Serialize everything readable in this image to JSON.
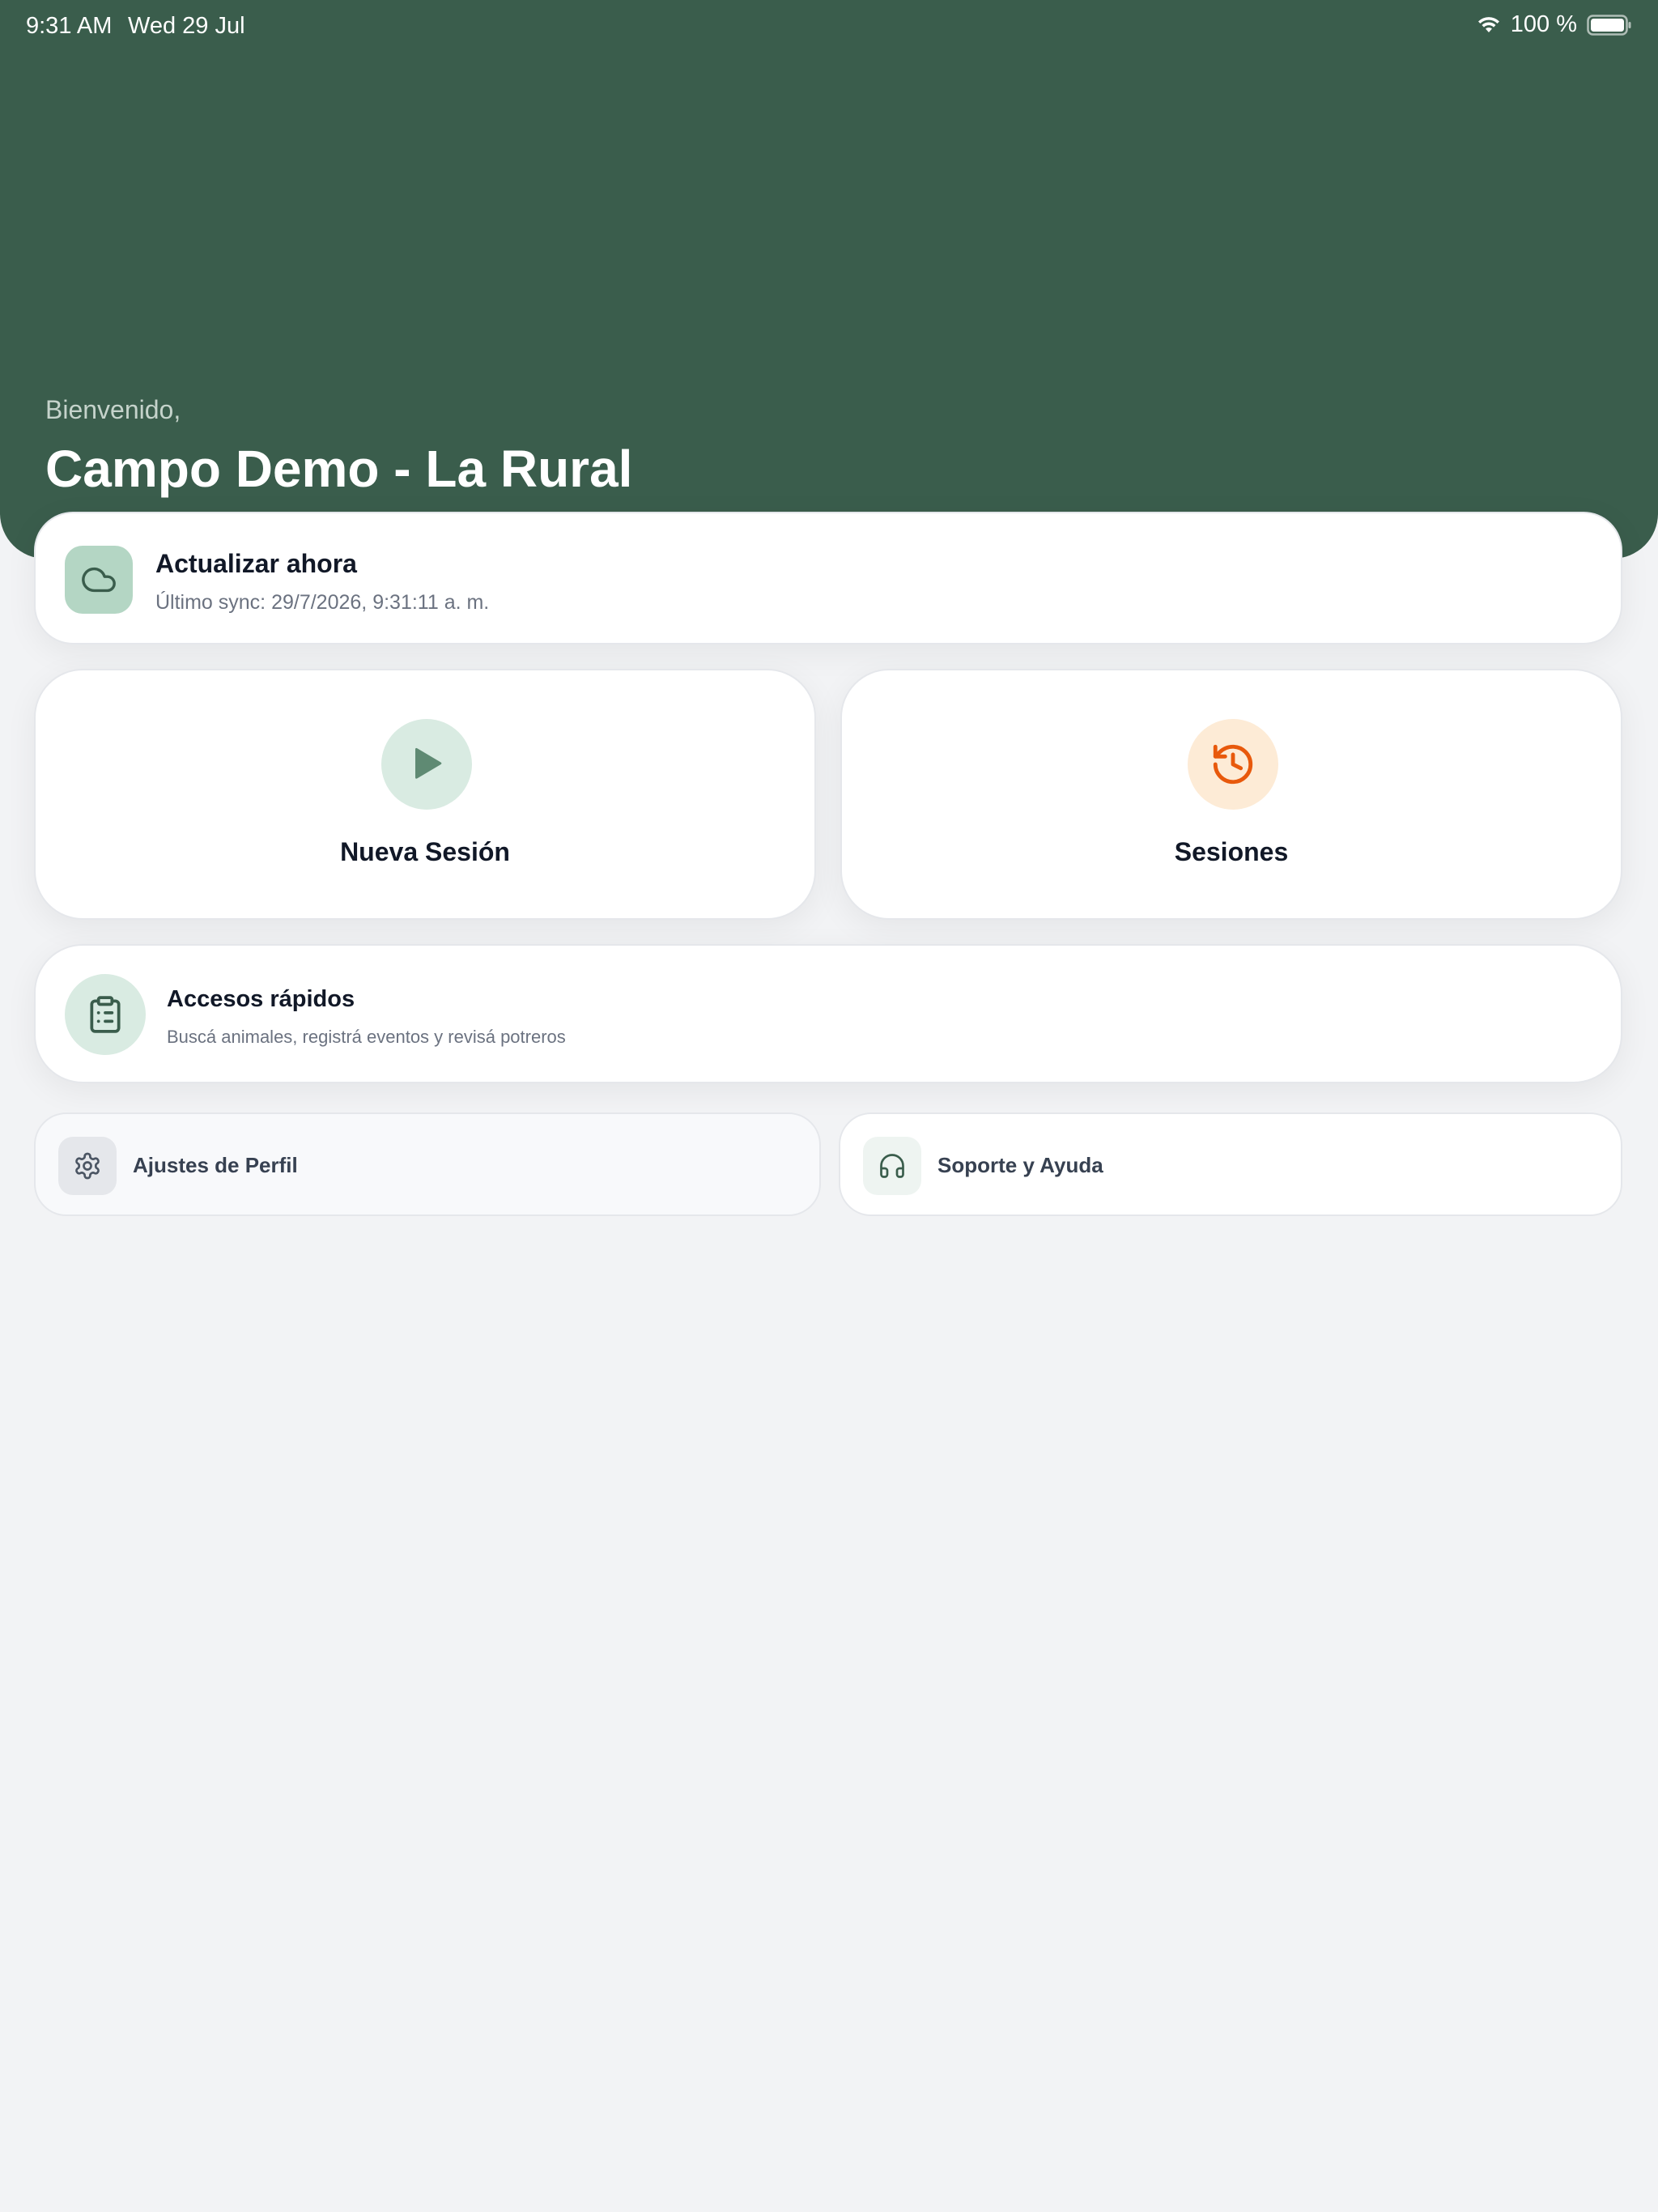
{
  "status_bar": {
    "time": "9:31 AM",
    "date": "Wed 29 Jul",
    "battery": "100 %"
  },
  "header": {
    "greeting": "Bienvenido,",
    "farm_name": "Campo Demo - La Rural"
  },
  "sync": {
    "title": "Actualizar ahora",
    "subtitle": "Último sync: 29/7/2026, 9:31:11 a. m.",
    "icon": "cloud-icon"
  },
  "actions": {
    "new_session": {
      "label": "Nueva Sesión",
      "icon": "play-icon"
    },
    "sessions": {
      "label": "Sesiones",
      "icon": "history-icon"
    }
  },
  "quick_access": {
    "title": "Accesos rápidos",
    "subtitle": "Buscá animales, registrá eventos y revisá potreros",
    "icon": "clipboard-list-icon"
  },
  "shortcuts": {
    "profile": {
      "label": "Ajustes de Perfil",
      "icon": "gear-icon"
    },
    "support": {
      "label": "Soporte y Ayuda",
      "icon": "headphones-icon"
    }
  },
  "colors": {
    "header_bg": "#3a5d4c",
    "accent_green": "#5f8a73",
    "accent_orange": "#e8590c",
    "page_bg": "#f2f3f5"
  }
}
